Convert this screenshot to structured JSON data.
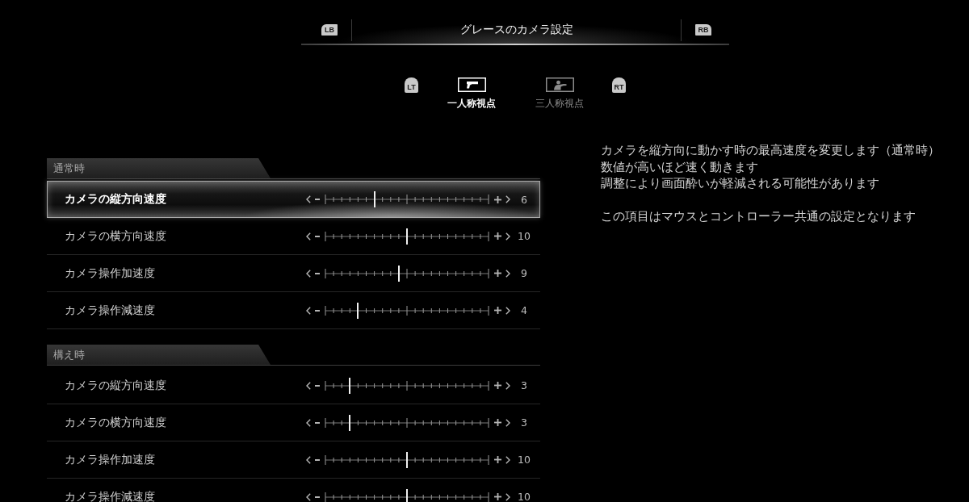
{
  "title_bar": {
    "left_hint": "LB",
    "title": "グレースのカメラ設定",
    "right_hint": "RB"
  },
  "view_tabs": {
    "left_hint": "LT",
    "right_hint": "RT",
    "tabs": [
      {
        "label": "一人称視点",
        "selected": true
      },
      {
        "label": "三人称視点",
        "selected": false
      }
    ]
  },
  "sections": [
    {
      "title": "通常時",
      "rows": [
        {
          "label": "カメラの縦方向速度",
          "level": 0.3,
          "reading": "6",
          "selected": true
        },
        {
          "label": "カメラの横方向速度",
          "level": 0.5,
          "reading": "10",
          "selected": false
        },
        {
          "label": "カメラ操作加速度",
          "level": 0.45,
          "reading": "9",
          "selected": false
        },
        {
          "label": "カメラ操作減速度",
          "level": 0.2,
          "reading": "4",
          "selected": false
        }
      ]
    },
    {
      "title": "構え時",
      "rows": [
        {
          "label": "カメラの縦方向速度",
          "level": 0.15,
          "reading": "3",
          "selected": false
        },
        {
          "label": "カメラの横方向速度",
          "level": 0.15,
          "reading": "3",
          "selected": false
        },
        {
          "label": "カメラ操作加速度",
          "level": 0.5,
          "reading": "10",
          "selected": false
        },
        {
          "label": "カメラ操作減速度",
          "level": 0.5,
          "reading": "10",
          "selected": false
        }
      ]
    }
  ],
  "description": [
    [
      "カメラを縦方向に動かす時の最高速度を変更します（通常時）",
      "数値が高いほど速く動きます",
      "調整により画面酔いが軽減される可能性があります"
    ],
    [
      "この項目はマウスとコントローラー共通の設定となります"
    ]
  ]
}
